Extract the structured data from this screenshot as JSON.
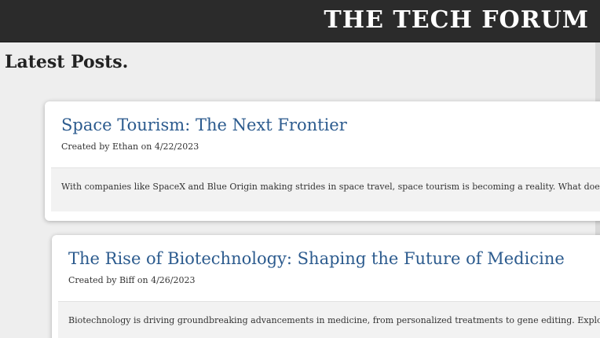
{
  "header": {
    "site_title": "THE TECH FORUM"
  },
  "page": {
    "heading": "Latest Posts."
  },
  "posts": [
    {
      "title": "Space Tourism: The Next Frontier",
      "meta": "Created by Ethan on 4/22/2023",
      "excerpt": "With companies like SpaceX and Blue Origin making strides in space travel, space tourism is becoming a reality. What does"
    },
    {
      "title": "The Rise of Biotechnology: Shaping the Future of Medicine",
      "meta": "Created by Biff on 4/26/2023",
      "excerpt": "Biotechnology is driving groundbreaking advancements in medicine, from personalized treatments to gene editing. Explore"
    }
  ]
}
